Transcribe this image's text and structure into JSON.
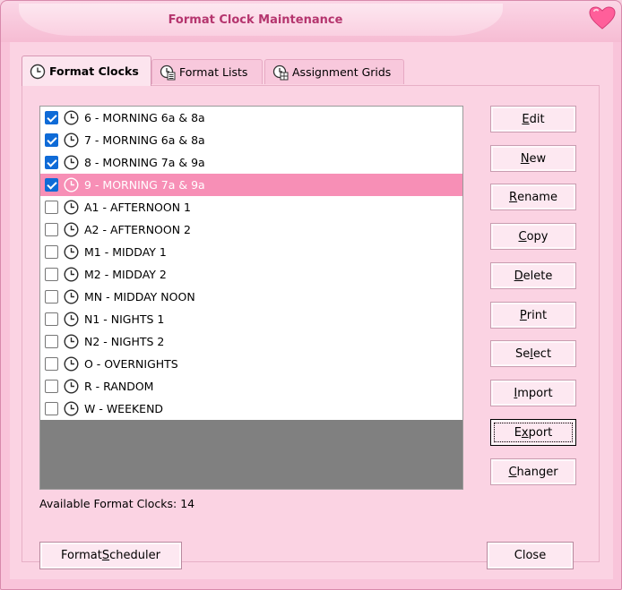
{
  "window": {
    "title": "Format Clock Maintenance"
  },
  "tabs": [
    {
      "label": "Format Clocks",
      "icon": "clock-icon",
      "active": true
    },
    {
      "label": "Format Lists",
      "icon": "list-icon",
      "active": false
    },
    {
      "label": "Assignment Grids",
      "icon": "grid-icon",
      "active": false
    }
  ],
  "clocks": [
    {
      "label": "6 - MORNING 6a & 8a",
      "checked": true,
      "selected": false
    },
    {
      "label": "7 - MORNING 6a & 8a",
      "checked": true,
      "selected": false
    },
    {
      "label": "8 - MORNING 7a & 9a",
      "checked": true,
      "selected": false
    },
    {
      "label": "9 - MORNING 7a & 9a",
      "checked": true,
      "selected": true
    },
    {
      "label": "A1 - AFTERNOON 1",
      "checked": false,
      "selected": false
    },
    {
      "label": "A2 - AFTERNOON 2",
      "checked": false,
      "selected": false
    },
    {
      "label": "M1 - MIDDAY 1",
      "checked": false,
      "selected": false
    },
    {
      "label": "M2 - MIDDAY 2",
      "checked": false,
      "selected": false
    },
    {
      "label": "MN - MIDDAY NOON",
      "checked": false,
      "selected": false
    },
    {
      "label": "N1 - NIGHTS 1",
      "checked": false,
      "selected": false
    },
    {
      "label": "N2 - NIGHTS 2",
      "checked": false,
      "selected": false
    },
    {
      "label": "O - OVERNIGHTS",
      "checked": false,
      "selected": false
    },
    {
      "label": "R - RANDOM",
      "checked": false,
      "selected": false
    },
    {
      "label": "W - WEEKEND",
      "checked": false,
      "selected": false
    }
  ],
  "buttons": {
    "edit": {
      "pre": "",
      "key": "E",
      "post": "dit"
    },
    "new": {
      "pre": "",
      "key": "N",
      "post": "ew"
    },
    "rename": {
      "pre": "",
      "key": "R",
      "post": "ename"
    },
    "copy": {
      "pre": "",
      "key": "C",
      "post": "opy"
    },
    "delete": {
      "pre": "",
      "key": "D",
      "post": "elete"
    },
    "print": {
      "pre": "",
      "key": "P",
      "post": "rint"
    },
    "select": {
      "pre": "Se",
      "key": "l",
      "post": "ect"
    },
    "import": {
      "pre": "",
      "key": "I",
      "post": "mport"
    },
    "export": {
      "pre": "E",
      "key": "x",
      "post": "port"
    },
    "changer": {
      "pre": "",
      "key": "C",
      "post": "hanger"
    }
  },
  "status": {
    "text": "Available Format Clocks: 14"
  },
  "footer": {
    "scheduler": {
      "pre": "Format ",
      "key": "S",
      "post": "cheduler"
    },
    "close": {
      "label": "Close"
    }
  },
  "colors": {
    "accent_pink": "#f78fb6",
    "title_text": "#b5356e",
    "check_blue": "#0f6bd7"
  }
}
